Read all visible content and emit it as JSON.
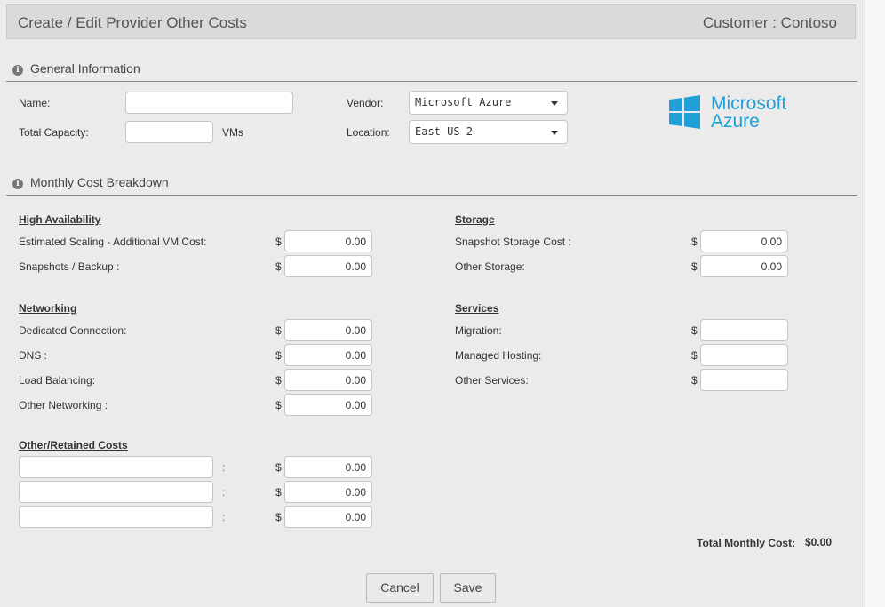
{
  "header": {
    "title": "Create / Edit Provider Other Costs",
    "customer": "Customer : Contoso"
  },
  "general": {
    "heading": "General Information",
    "name_label": "Name:",
    "name_value": "",
    "capacity_label": "Total Capacity:",
    "capacity_value": "",
    "capacity_unit": "VMs",
    "vendor_label": "Vendor:",
    "vendor_value": "Microsoft Azure",
    "location_label": "Location:",
    "location_value": "East US 2",
    "logo_line1": "Microsoft",
    "logo_line2": "Azure"
  },
  "breakdown": {
    "heading": "Monthly Cost Breakdown",
    "currency": "$",
    "separator": ":",
    "high_availability": {
      "title": "High Availability",
      "items": [
        {
          "label": "Estimated Scaling - Additional VM Cost:",
          "value": "0.00"
        },
        {
          "label": "Snapshots / Backup :",
          "value": "0.00"
        }
      ]
    },
    "networking": {
      "title": "Networking",
      "items": [
        {
          "label": "Dedicated Connection:",
          "value": "0.00"
        },
        {
          "label": "DNS :",
          "value": "0.00"
        },
        {
          "label": "Load Balancing:",
          "value": "0.00"
        },
        {
          "label": "Other Networking :",
          "value": "0.00"
        }
      ]
    },
    "storage": {
      "title": "Storage",
      "items": [
        {
          "label": "Snapshot Storage Cost :",
          "value": "0.00"
        },
        {
          "label": "Other Storage:",
          "value": "0.00"
        }
      ]
    },
    "services": {
      "title": "Services",
      "items": [
        {
          "label": "Migration:",
          "value": ""
        },
        {
          "label": "Managed Hosting:",
          "value": ""
        },
        {
          "label": "Other Services:",
          "value": ""
        }
      ]
    },
    "other_retained": {
      "title": "Other/Retained Costs",
      "rows": [
        {
          "name": "",
          "value": "0.00"
        },
        {
          "name": "",
          "value": "0.00"
        },
        {
          "name": "",
          "value": "0.00"
        }
      ]
    },
    "total_label": "Total Monthly Cost:",
    "total_value": "$0.00"
  },
  "buttons": {
    "cancel": "Cancel",
    "save": "Save"
  },
  "colors": {
    "azure_blue": "#1e9fd8",
    "background": "#ebebeb",
    "title_bar": "#dadada"
  }
}
